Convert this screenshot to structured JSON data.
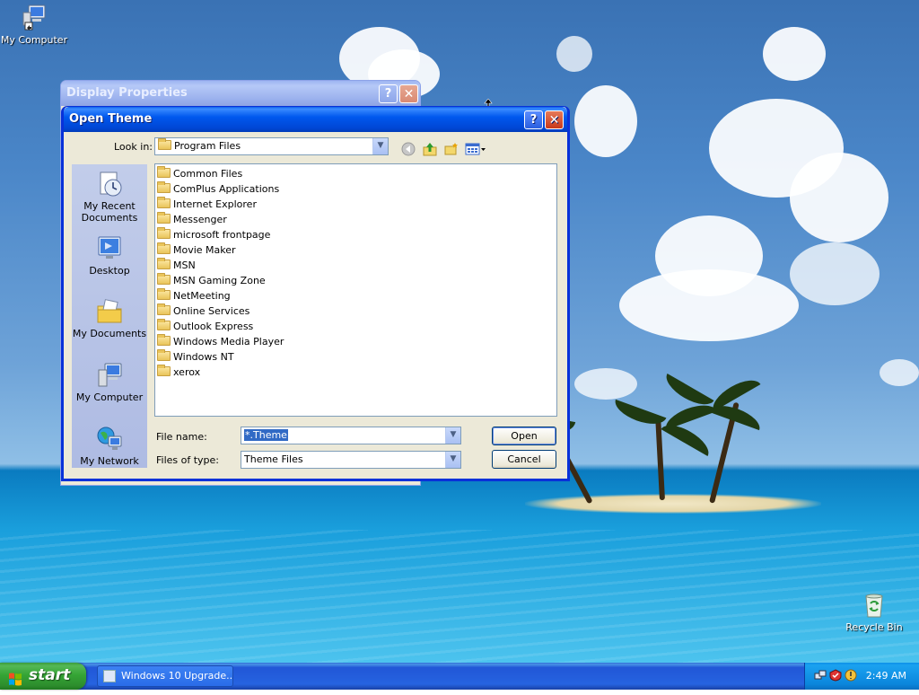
{
  "desktop": {
    "icons": [
      {
        "label": "My Computer",
        "icon": "my-computer-icon"
      },
      {
        "label": "Recycle Bin",
        "icon": "recycle-bin-icon"
      }
    ]
  },
  "display_properties": {
    "title": "Display Properties",
    "help_glyph": "?",
    "close_glyph": "✕"
  },
  "open_dialog": {
    "title": "Open Theme",
    "help_glyph": "?",
    "close_glyph": "✕",
    "look_in_label": "Look in:",
    "look_in_value": "Program Files",
    "toolbar": {
      "back_icon": "back-icon",
      "up_icon": "up-folder-icon",
      "new_folder_icon": "new-folder-icon",
      "views_icon": "views-menu-icon"
    },
    "places": [
      {
        "label": "My Recent Documents",
        "icon": "recent-documents-icon"
      },
      {
        "label": "Desktop",
        "icon": "desktop-icon"
      },
      {
        "label": "My Documents",
        "icon": "my-documents-icon"
      },
      {
        "label": "My Computer",
        "icon": "my-computer-icon"
      },
      {
        "label": "My Network",
        "icon": "my-network-icon"
      }
    ],
    "files": [
      "Common Files",
      "ComPlus Applications",
      "Internet Explorer",
      "Messenger",
      "microsoft frontpage",
      "Movie Maker",
      "MSN",
      "MSN Gaming Zone",
      "NetMeeting",
      "Online Services",
      "Outlook Express",
      "Windows Media Player",
      "Windows NT",
      "xerox"
    ],
    "file_name_label": "File name:",
    "file_name_value": "*.Theme",
    "files_of_type_label": "Files of type:",
    "files_of_type_value": "Theme Files",
    "open_button": "Open",
    "cancel_button": "Cancel"
  },
  "taskbar": {
    "start_label": "start",
    "tasks": [
      {
        "label": "Windows 10 Upgrade..."
      }
    ],
    "clock": "2:49 AM"
  },
  "colors": {
    "title_active": "#0058ee",
    "start_green": "#35a535",
    "taskbar_blue": "#2663e0"
  }
}
